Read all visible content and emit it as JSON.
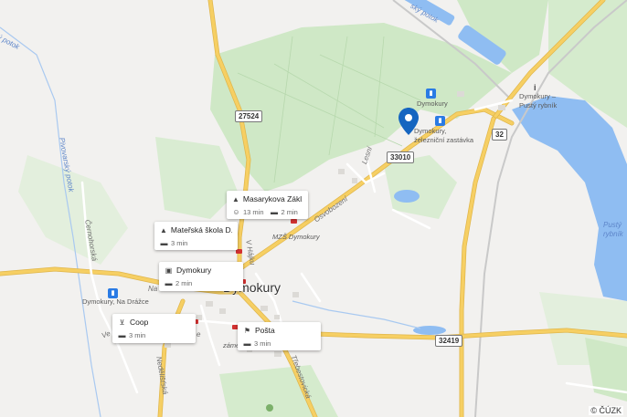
{
  "places": {
    "town": "Dymokury",
    "station": "Dymokury, železniční zastávka",
    "station_north": "Dymokury",
    "stop_west": "Dymokury, Na Drážce",
    "pond": "Dymokury – Pustý rybník",
    "pond_water": "Pustý rybník",
    "school_label": "MZŠ Dymokury",
    "zamek": "zámek"
  },
  "streets": {
    "potok_nw": "ý potok",
    "pivovarsky": "Pivovarský potok",
    "cernohorska": "Černohorská",
    "nedelistska": "Nedělišťská",
    "osvobozeni": "Osvobození",
    "lesni": "Lesní",
    "vrsku": "V Hájku",
    "potok_ne": "ský potok",
    "na": "Na",
    "ve": "Ve",
    "ulice_e": "e",
    "trebestovicka": "Třebestovická"
  },
  "road_numbers": {
    "r27524": "27524",
    "r33010": "33010",
    "r32": "32",
    "r32419": "32419"
  },
  "cards": [
    {
      "title": "Masarykova Zákl...",
      "title_icon": "school-icon",
      "sub1": "13 min",
      "sub1_icon": "walk-icon",
      "sub2": "2 min",
      "sub2_icon": "car-icon"
    },
    {
      "title": "Mateřská škola D...",
      "title_icon": "school-icon",
      "sub1": "3 min",
      "sub1_icon": "car-icon"
    },
    {
      "title": "Dymokury",
      "title_icon": "bus-icon",
      "sub1": "2 min",
      "sub1_icon": "car-icon"
    },
    {
      "title": "Coop",
      "title_icon": "cart-icon",
      "sub1": "3 min",
      "sub1_icon": "car-icon"
    },
    {
      "title": "Pošta",
      "title_icon": "post-icon",
      "sub1": "3 min",
      "sub1_icon": "car-icon"
    }
  ],
  "colors": {
    "land": "#f2f1ef",
    "forest": "#c8e6bf",
    "water": "#8fbdf2",
    "road_major": "#f6cf63",
    "road_minor": "#ffffff",
    "marker": "#1565c0",
    "poi_red": "#d23232"
  },
  "copyright": "© ČÚZK"
}
